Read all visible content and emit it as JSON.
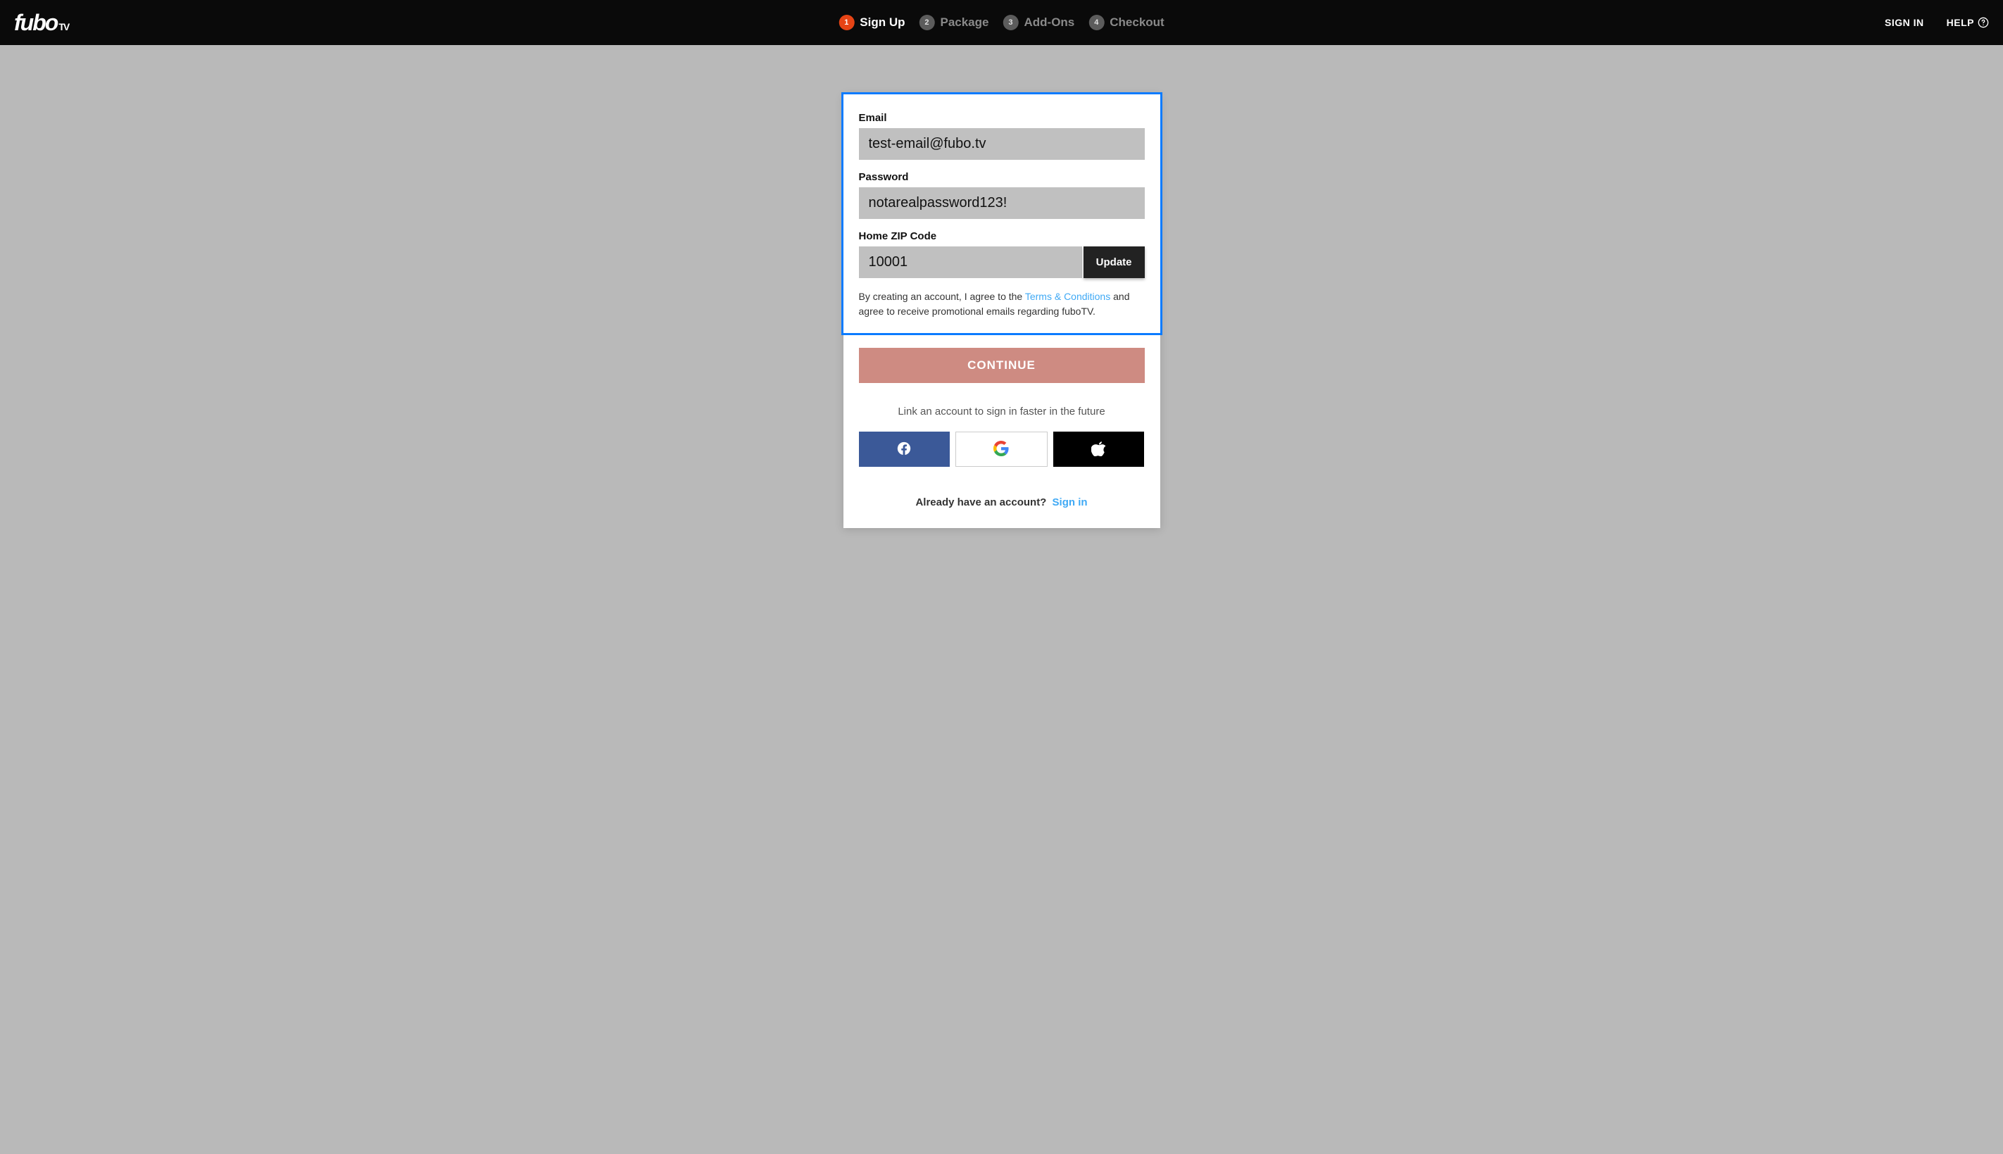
{
  "header": {
    "logo_main": "fubo",
    "logo_sub": "TV",
    "steps": [
      {
        "num": "1",
        "label": "Sign Up",
        "active": true
      },
      {
        "num": "2",
        "label": "Package",
        "active": false
      },
      {
        "num": "3",
        "label": "Add-Ons",
        "active": false
      },
      {
        "num": "4",
        "label": "Checkout",
        "active": false
      }
    ],
    "signin": "SIGN IN",
    "help": "HELP"
  },
  "form": {
    "email_label": "Email",
    "email_value": "test-email@fubo.tv",
    "password_label": "Password",
    "password_value": "notarealpassword123!",
    "zip_label": "Home ZIP Code",
    "zip_value": "10001",
    "update_label": "Update",
    "legal_before": "By creating an account, I agree to the ",
    "legal_link": "Terms & Conditions",
    "legal_after": " and agree to receive promotional emails regarding fuboTV.",
    "continue_label": "CONTINUE",
    "link_account_text": "Link an account to sign in faster in the future",
    "already_text": "Already have an account?",
    "already_link": "Sign in"
  }
}
